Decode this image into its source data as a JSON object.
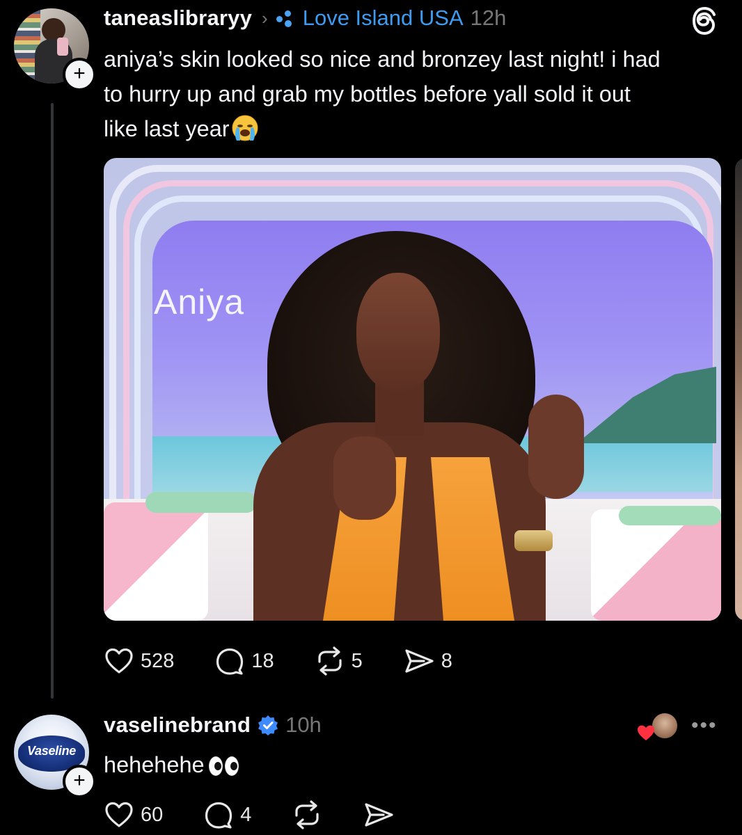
{
  "post": {
    "username": "taneaslibraryy",
    "topic": "Love Island USA",
    "time": "12h",
    "text_line1": "aniya’s skin looked so nice and bronzey last night! i had",
    "text_line2": "to hurry up and grab my bottles before yall sold it out",
    "text_line3": "like last year",
    "media_label": "Aniya",
    "likes": "528",
    "comments": "18",
    "reposts": "5",
    "shares": "8"
  },
  "reply": {
    "username": "vaselinebrand",
    "avatar_text": "Vaseline",
    "time": "10h",
    "text": "hehehehe",
    "likes": "60",
    "comments": "4"
  },
  "icons": {
    "follow_plus": "+",
    "chevron": "›",
    "more": "•••"
  },
  "colors": {
    "topic": "#3d9cf2",
    "verified": "#3d8bfd",
    "like_badge": "#ff3040"
  }
}
